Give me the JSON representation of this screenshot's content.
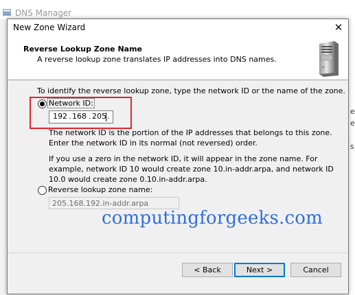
{
  "background": {
    "title": "DNS Manager",
    "right_fragments": [
      "e",
      "e",
      "s"
    ]
  },
  "dialog": {
    "title": "New Zone Wizard",
    "close_glyph": "✕",
    "header_title": "Reverse Lookup Zone Name",
    "header_subtitle": "A reverse lookup zone translates IP addresses into DNS names.",
    "instruction": "To identify the reverse lookup zone, type the network ID or the name of the zone.",
    "network_id": {
      "label": "Network ID:",
      "selected": true,
      "octets": [
        "192",
        "168",
        "205",
        ""
      ],
      "dots": [
        ".",
        ".",
        "."
      ]
    },
    "desc1": "The network ID is the portion of the IP addresses that belongs to this zone. Enter the network ID in its normal (not reversed) order.",
    "desc2": "If you use a zero in the network ID, it will appear in the zone name. For example, network ID 10 would create zone 10.in-addr.arpa, and network ID 10.0 would create zone 0.10.in-addr.arpa.",
    "reverse_name": {
      "label": "Reverse lookup zone name:",
      "selected": false,
      "value": "205.168.192.in-addr.arpa"
    },
    "watermark": "computingforgeeks.com",
    "buttons": {
      "back": "< Back",
      "next": "Next >",
      "cancel": "Cancel"
    }
  },
  "colors": {
    "highlight": "#e0242b",
    "accent": "#0078d7",
    "watermark": "#2f6edc"
  }
}
